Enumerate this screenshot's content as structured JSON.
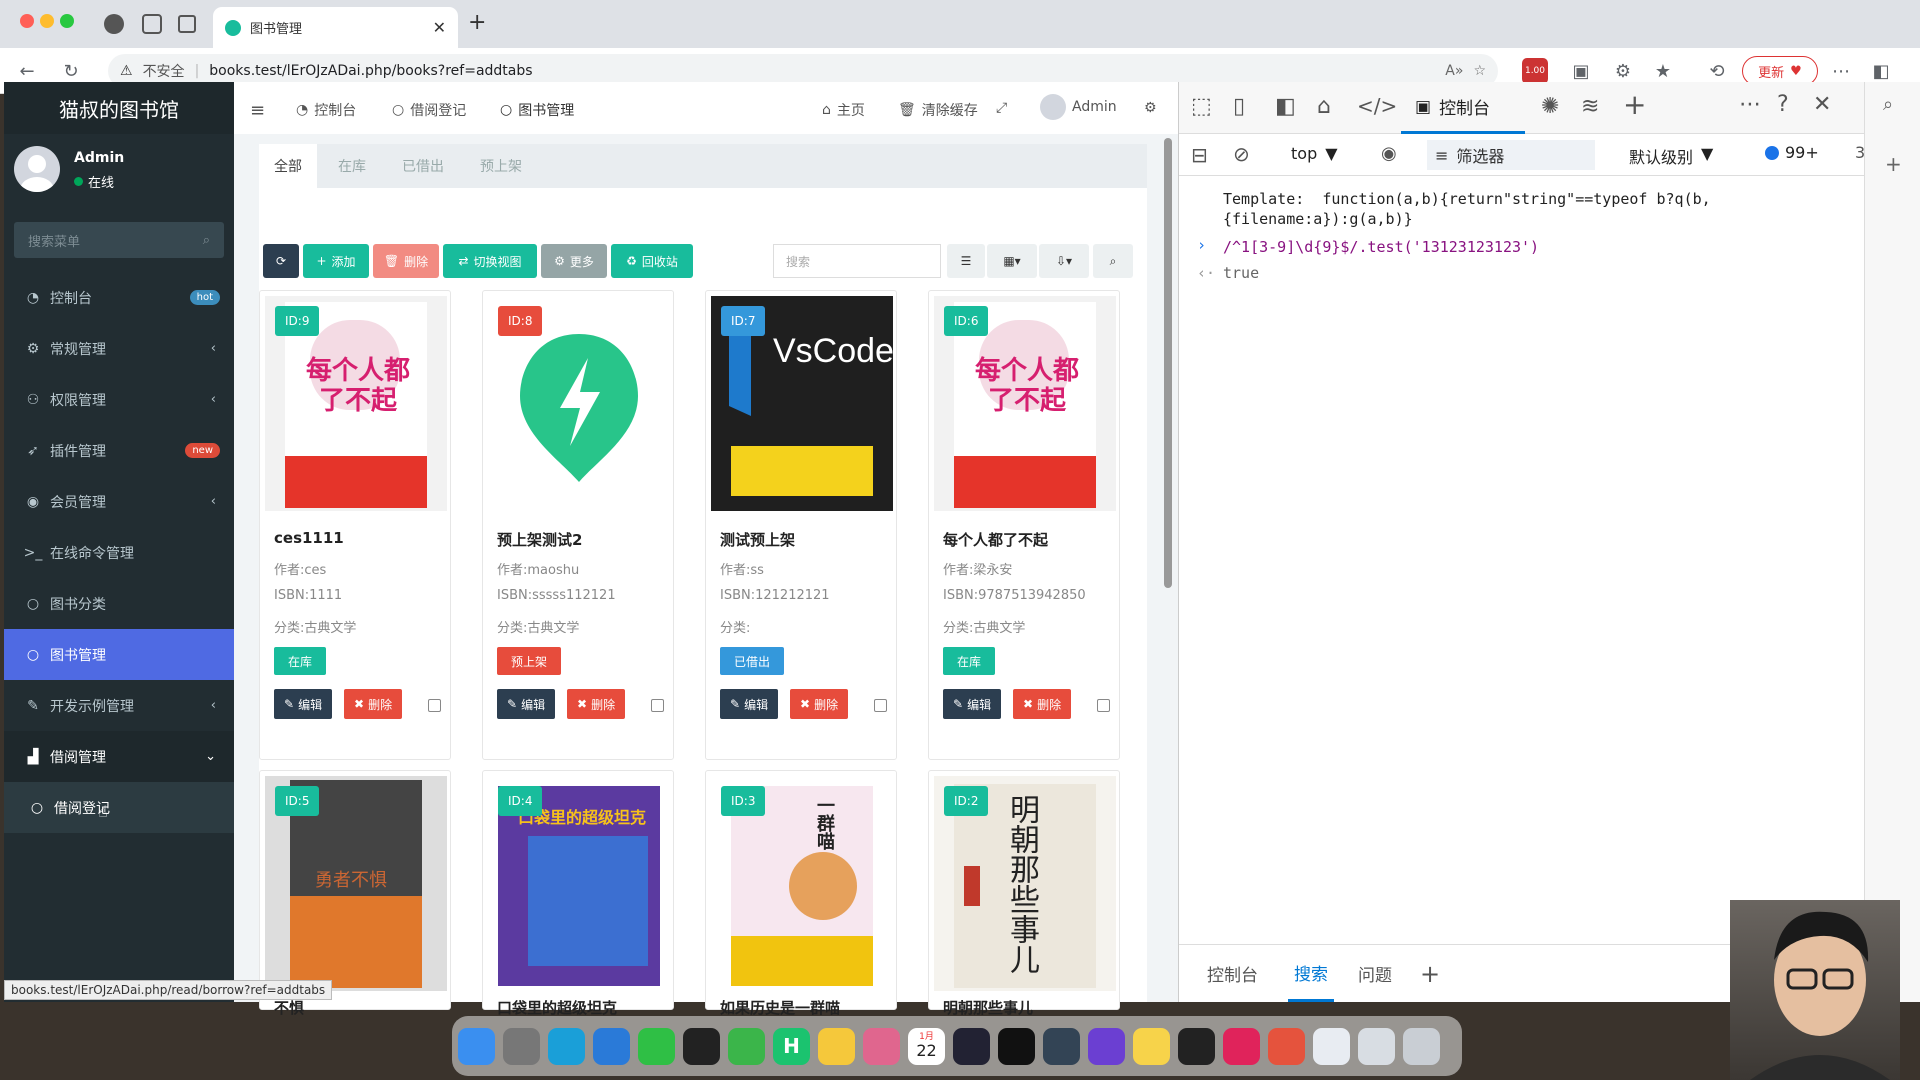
{
  "browser": {
    "tab_title": "图书管理",
    "security_label": "不安全",
    "url": "books.test/lErOJzADai.php/books?ref=addtabs",
    "update_label": "更新",
    "ext_badge": "1.00"
  },
  "sidebar": {
    "brand": "猫叔的图书馆",
    "user_name": "Admin",
    "user_status": "在线",
    "search_placeholder": "搜索菜单",
    "items": [
      {
        "label": "控制台",
        "icon": "dashboard-icon",
        "badge": "hot",
        "badge_color": "#3c8dbc"
      },
      {
        "label": "常规管理",
        "icon": "cogs-icon",
        "arrow": "‹"
      },
      {
        "label": "权限管理",
        "icon": "group-icon",
        "arrow": "‹"
      },
      {
        "label": "插件管理",
        "icon": "rocket-icon",
        "badge": "new",
        "badge_color": "#dd4b39"
      },
      {
        "label": "会员管理",
        "icon": "user-icon",
        "arrow": "‹"
      },
      {
        "label": "在线命令管理",
        "icon": "terminal-icon"
      },
      {
        "label": "图书分类",
        "icon": "circle-icon"
      },
      {
        "label": "图书管理",
        "icon": "circle-icon"
      },
      {
        "label": "开发示例管理",
        "icon": "magic-icon",
        "arrow": "‹"
      },
      {
        "label": "借阅管理",
        "icon": "chart-icon",
        "arrow": "⌄"
      },
      {
        "label": "借阅登记",
        "icon": "circle-icon"
      }
    ]
  },
  "topnav": {
    "tabs": [
      "控制台",
      "借阅登记",
      "图书管理"
    ],
    "home": "主页",
    "clear_cache": "清除缓存",
    "admin": "Admin"
  },
  "filter_tabs": [
    "全部",
    "在库",
    "已借出",
    "预上架"
  ],
  "toolbar": {
    "add": "添加",
    "delete": "删除",
    "switch_view": "切换视图",
    "more": "更多",
    "recycle": "回收站",
    "search_placeholder": "搜索"
  },
  "books": [
    {
      "id": "ID:9",
      "id_color": "#18bc9c",
      "title": "ces1111",
      "author": "作者:ces",
      "isbn": "ISBN:1111",
      "category": "分类:古典文学",
      "status": "在库",
      "status_color": "#18bc9c",
      "cover": "每个人都了不起"
    },
    {
      "id": "ID:8",
      "id_color": "#e74c3c",
      "title": "预上架测试2",
      "author": "作者:maoshu",
      "isbn": "ISBN:sssss112121",
      "category": "分类:古典文学",
      "status": "预上架",
      "status_color": "#e74c3c",
      "cover": ""
    },
    {
      "id": "ID:7",
      "id_color": "#3498db",
      "title": "测试预上架",
      "author": "作者:ss",
      "isbn": "ISBN:121212121",
      "category": "分类:",
      "status": "已借出",
      "status_color": "#3498db",
      "cover": "VsCode"
    },
    {
      "id": "ID:6",
      "id_color": "#18bc9c",
      "title": "每个人都了不起",
      "author": "作者:梁永安",
      "isbn": "ISBN:9787513942850",
      "category": "分类:古典文学",
      "status": "在库",
      "status_color": "#18bc9c",
      "cover": "每个人都了不起"
    },
    {
      "id": "ID:5",
      "id_color": "#18bc9c",
      "title": "不惧",
      "cover": "勇者不惧"
    },
    {
      "id": "ID:4",
      "id_color": "#18bc9c",
      "title": "口袋里的超级坦克",
      "cover": "口袋里的超级坦克"
    },
    {
      "id": "ID:3",
      "id_color": "#18bc9c",
      "title": "如果历史是一群喵",
      "cover": "一群喵"
    },
    {
      "id": "ID:2",
      "id_color": "#18bc9c",
      "title": "明朝那些事儿",
      "cover": "明朝那些事儿"
    }
  ],
  "card_actions": {
    "edit": "编辑",
    "delete": "删除"
  },
  "devtools": {
    "console_tab": "控制台",
    "context": "top",
    "filter": "筛选器",
    "level": "默认级别",
    "issue_count": "99+",
    "extra_count": "3",
    "log_line1": "Template:  function(a,b){return\"string\"==typeof b?q(b,",
    "log_line2": "{filename:a}):g(a,b)}",
    "input_expr": "/^1[3-9]\\d{9}$/.test('13123123123')",
    "output": "true",
    "bottom_tabs": [
      "控制台",
      "搜索",
      "问题"
    ]
  },
  "status_url": "books.test/lErOJzADai.php/read/borrow?ref=addtabs",
  "dock": {
    "calendar_month": "1月",
    "calendar_day": "22"
  }
}
